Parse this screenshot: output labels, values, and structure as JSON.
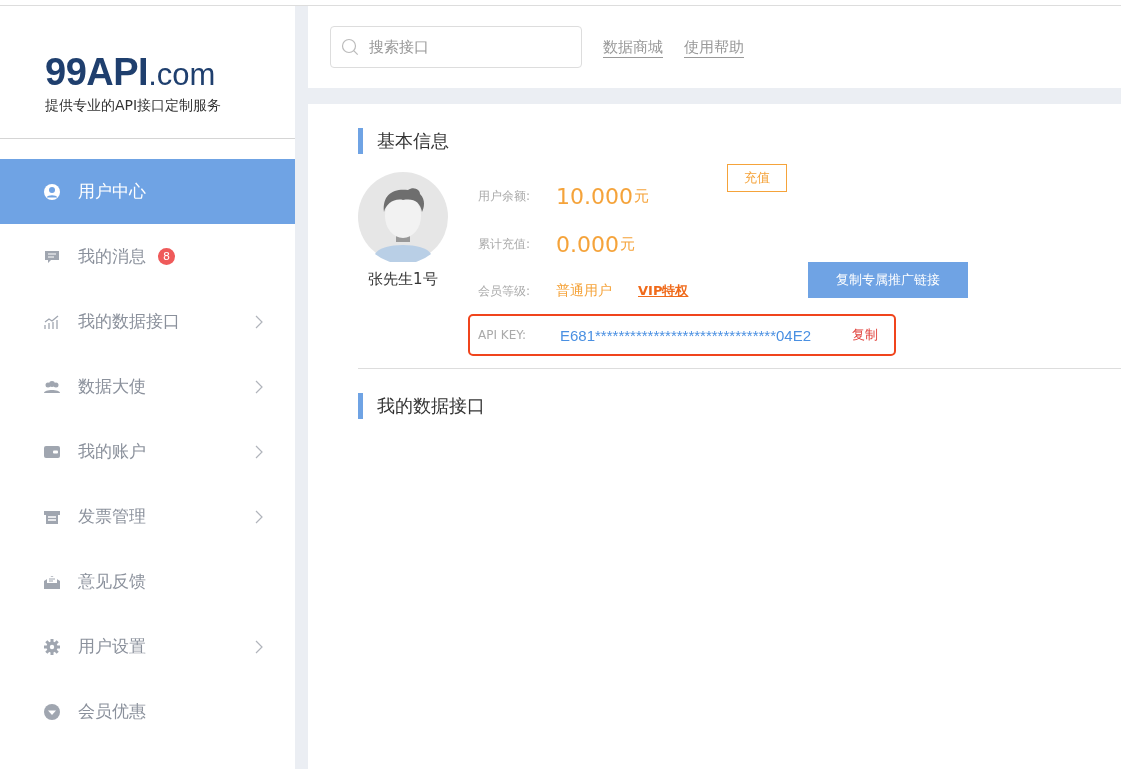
{
  "logo": {
    "brand": "99API",
    "suffix": ".com",
    "tagline": "提供专业的API接口定制服务"
  },
  "sidebar": {
    "items": [
      {
        "label": "用户中心",
        "selected": true,
        "expandable": false
      },
      {
        "label": "我的消息",
        "selected": false,
        "expandable": false,
        "badge": "8"
      },
      {
        "label": "我的数据接口",
        "selected": false,
        "expandable": true
      },
      {
        "label": "数据大使",
        "selected": false,
        "expandable": true
      },
      {
        "label": "我的账户",
        "selected": false,
        "expandable": true
      },
      {
        "label": "发票管理",
        "selected": false,
        "expandable": true
      },
      {
        "label": "意见反馈",
        "selected": false,
        "expandable": false
      },
      {
        "label": "用户设置",
        "selected": false,
        "expandable": true
      },
      {
        "label": "会员优惠",
        "selected": false,
        "expandable": false
      }
    ]
  },
  "header": {
    "search": {
      "placeholder": "搜索接口"
    },
    "links": [
      "数据商城",
      "使用帮助"
    ]
  },
  "basic_info": {
    "title": "基本信息",
    "username": "张先生1号",
    "balance": {
      "label": "用户余额:",
      "amount": "10.000",
      "unit": "元",
      "button": "充值"
    },
    "total_recharge": {
      "label": "累计充值:",
      "amount": "0.000",
      "unit": "元"
    },
    "membership": {
      "label": "会员等级:",
      "level": "普通用户",
      "link": "VIP特权"
    },
    "promo_button": "复制专属推广链接",
    "api_key": {
      "label": "API KEY:",
      "value": "E681*******************************04E2",
      "copy": "复制"
    }
  },
  "interfaces": {
    "title": "我的数据接口"
  }
}
